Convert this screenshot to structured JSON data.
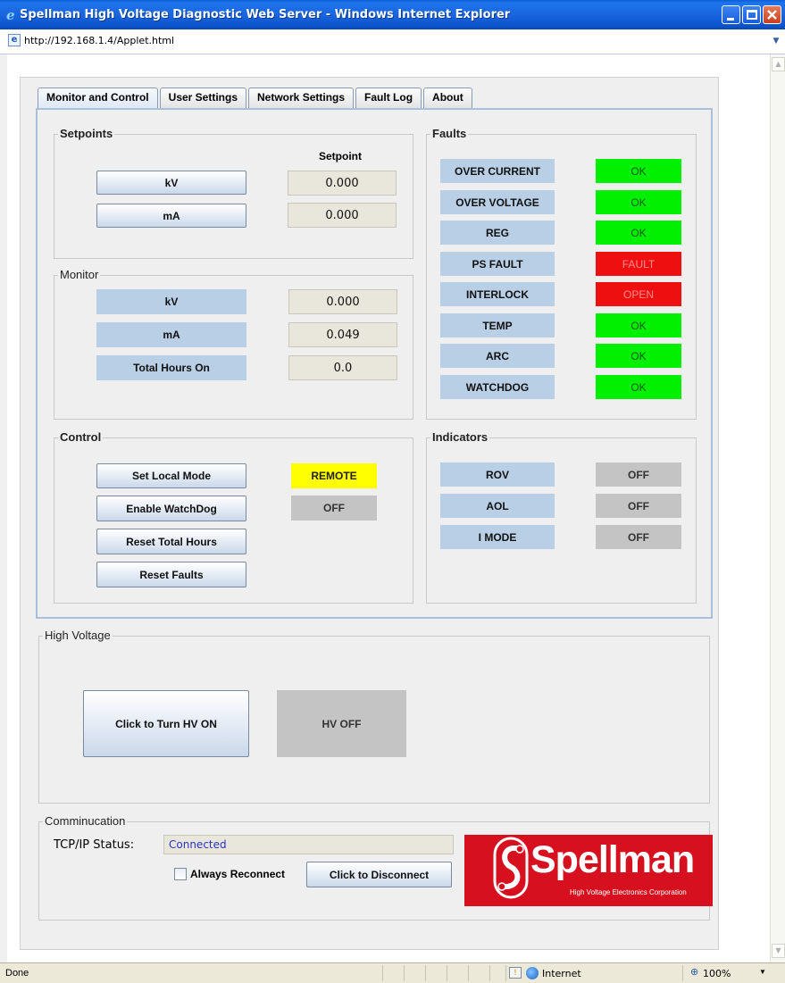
{
  "window": {
    "title": "Spellman High Voltage Diagnostic Web Server - Windows Internet Explorer"
  },
  "address": {
    "url": "http://192.168.1.4/Applet.html"
  },
  "tabs": [
    {
      "label": "Monitor and Control"
    },
    {
      "label": "User Settings"
    },
    {
      "label": "Network Settings"
    },
    {
      "label": "Fault Log"
    },
    {
      "label": "About"
    }
  ],
  "setpoints": {
    "title": "Setpoints",
    "column_header": "Setpoint",
    "kv_button": "kV",
    "ma_button": "mA",
    "kv_value": "0.000",
    "ma_value": "0.000"
  },
  "monitor": {
    "title": "Monitor",
    "rows": [
      {
        "label": "kV",
        "value": "0.000"
      },
      {
        "label": "mA",
        "value": "0.049"
      },
      {
        "label": "Total Hours On",
        "value": "0.0"
      }
    ]
  },
  "control": {
    "title": "Control",
    "set_local_mode": "Set Local Mode",
    "enable_watchdog": "Enable WatchDog",
    "reset_total_hours": "Reset Total Hours",
    "reset_faults": "Reset Faults",
    "mode_status": "REMOTE",
    "watchdog_status": "OFF"
  },
  "faults": {
    "title": "Faults",
    "rows": [
      {
        "label": "OVER CURRENT",
        "status": "OK",
        "color": "#00f000"
      },
      {
        "label": "OVER VOLTAGE",
        "status": "OK",
        "color": "#00f000"
      },
      {
        "label": "REG",
        "status": "OK",
        "color": "#00f000"
      },
      {
        "label": "PS FAULT",
        "status": "FAULT",
        "color": "#ee1010"
      },
      {
        "label": "INTERLOCK",
        "status": "OPEN",
        "color": "#ee1010"
      },
      {
        "label": "TEMP",
        "status": "OK",
        "color": "#00f000"
      },
      {
        "label": "ARC",
        "status": "OK",
        "color": "#00f000"
      },
      {
        "label": "WATCHDOG",
        "status": "OK",
        "color": "#00f000"
      }
    ]
  },
  "indicators": {
    "title": "Indicators",
    "rows": [
      {
        "label": "ROV",
        "status": "OFF"
      },
      {
        "label": "AOL",
        "status": "OFF"
      },
      {
        "label": "I MODE",
        "status": "OFF"
      }
    ]
  },
  "high_voltage": {
    "title": "High Voltage",
    "button": "Click to Turn HV ON",
    "status": "HV OFF"
  },
  "communication": {
    "title": "Comminucation",
    "tcp_label": "TCP/IP Status:",
    "tcp_value": "Connected",
    "always_reconnect": "Always Reconnect",
    "disconnect_button": "Click to Disconnect"
  },
  "logo": {
    "name": "Spellman",
    "tagline": "High Voltage Electronics Corporation",
    "color": "#d6101e"
  },
  "statusbar": {
    "left": "Done",
    "zone": "Internet",
    "zoom": "100%"
  }
}
